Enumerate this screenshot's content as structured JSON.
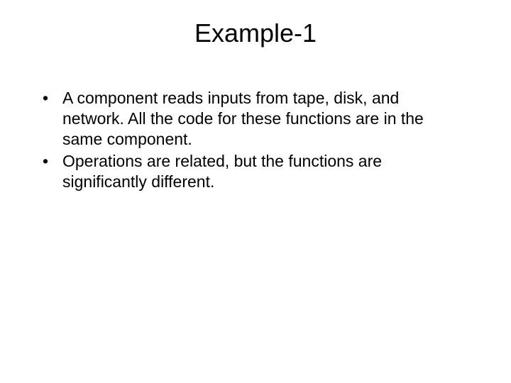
{
  "slide": {
    "title": "Example-1",
    "bullets": [
      "A component reads inputs from tape, disk, and network. All the code for these functions are in the same component.",
      "Operations are related, but the functions are significantly different."
    ]
  }
}
